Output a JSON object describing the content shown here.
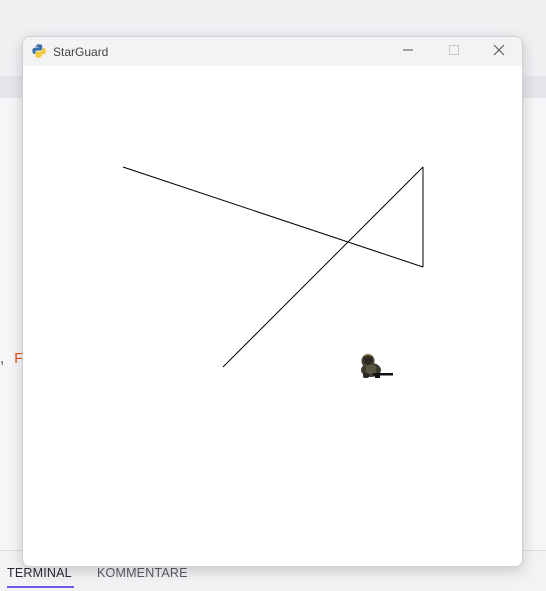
{
  "window": {
    "title": "StarGuard",
    "icon": "python-icon",
    "controls": [
      "minimize-icon",
      "maximize-icon",
      "close-icon"
    ]
  },
  "background": {
    "fragment_comma": ",",
    "fragment_letter": "F",
    "accent_color": "#e2571e"
  },
  "bottom_panel": {
    "tabs": [
      {
        "label": "TERMINAL",
        "active": true
      },
      {
        "label": "KOMMENTARE",
        "active": false
      }
    ],
    "active_tab_color": "#6b5ce7"
  },
  "game": {
    "sprite": "soldier-sprite",
    "line_color": "#000000"
  }
}
